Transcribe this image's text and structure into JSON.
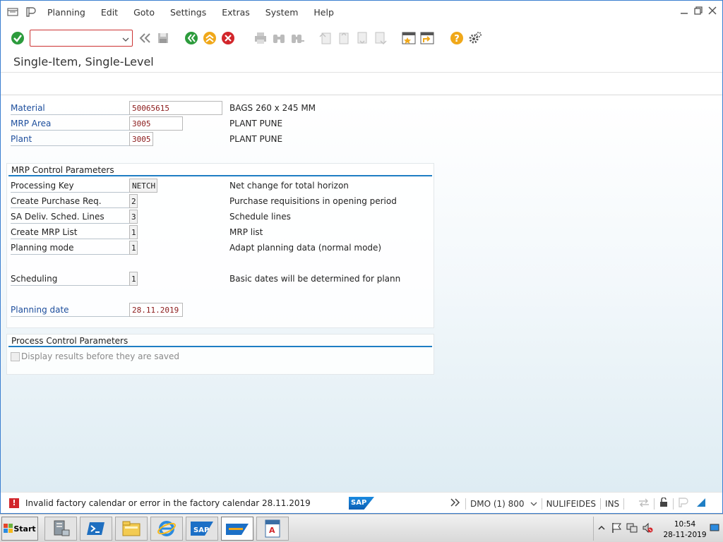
{
  "menubar": {
    "items": [
      "Planning",
      "Edit",
      "Goto",
      "Settings",
      "Extras",
      "System",
      "Help"
    ]
  },
  "toolbar": {
    "command_field_value": "",
    "icons": [
      "enter-icon",
      "back-arrows-icon",
      "save-icon",
      "back-icon",
      "exit-icon",
      "cancel-icon",
      "print-icon",
      "find-icon",
      "find-next-icon",
      "first-page-icon",
      "previous-page-icon",
      "next-page-icon",
      "last-page-icon",
      "create-session-icon",
      "shortcut-icon",
      "help-icon",
      "customize-layout-icon"
    ]
  },
  "page": {
    "title": "Single-Item, Single-Level"
  },
  "header_fields": {
    "material": {
      "label": "Material",
      "value": "50065615",
      "desc": "BAGS 260 x 245 MM"
    },
    "mrp_area": {
      "label": "MRP Area",
      "value": "3005",
      "desc": "PLANT PUNE"
    },
    "plant": {
      "label": "Plant",
      "value": "3005",
      "desc": "PLANT PUNE"
    }
  },
  "mrp_control": {
    "title": "MRP Control Parameters",
    "processing_key": {
      "label": "Processing Key",
      "value": "NETCH",
      "desc": "Net change for total horizon"
    },
    "create_purchase_req": {
      "label": "Create Purchase Req.",
      "value": "2",
      "desc": "Purchase requisitions in opening period"
    },
    "sa_deliv": {
      "label": "SA Deliv. Sched. Lines",
      "value": "3",
      "desc": "Schedule lines"
    },
    "create_mrp_list": {
      "label": "Create MRP List",
      "value": "1",
      "desc": "MRP list"
    },
    "planning_mode": {
      "label": "Planning mode",
      "value": "1",
      "desc": "Adapt planning data (normal mode)"
    },
    "scheduling": {
      "label": "Scheduling",
      "value": "1",
      "desc": "Basic dates will be determined for plann"
    },
    "planning_date": {
      "label": "Planning date",
      "value": "28.11.2019"
    }
  },
  "process_control": {
    "title": "Process Control Parameters",
    "display_results_label": "Display results before they are saved",
    "display_results_checked": false
  },
  "statusbar": {
    "message": "Invalid factory calendar or error in the factory calendar 28.11.2019",
    "logo_text": "SAP",
    "system": "DMO (1) 800",
    "server": "NULIFEIDES",
    "mode": "INS"
  },
  "taskbar": {
    "start_label": "Start",
    "tasks": [
      "server-manager",
      "powershell",
      "file-explorer",
      "internet-explorer",
      "sap-logon",
      "sap-gui",
      "document"
    ],
    "clock_time": "10:54",
    "clock_date": "28-11-2019"
  },
  "colors": {
    "accent_blue": "#1f7ec4",
    "label_blue": "#1c4d9c",
    "error_red": "#d2262b",
    "value_red": "#8b1a1a"
  }
}
